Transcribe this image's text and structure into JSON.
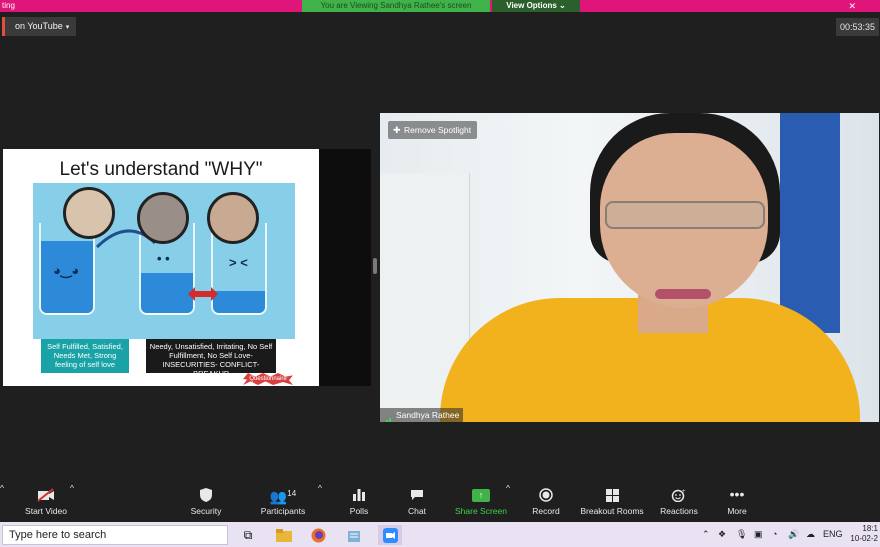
{
  "topbar": {
    "app_title": "ting",
    "viewing_banner": "You are Viewing Sandhya Rathee's screen",
    "view_options": "View Options",
    "close": "✕"
  },
  "live": {
    "label": "on YouTube",
    "caret": "▾"
  },
  "timer": "00:53:35",
  "slide": {
    "title": "Let's understand \"WHY\"",
    "caption_left": "Self Fulfilled, Satisfied, Needs Met, Strong feeling of self love",
    "caption_right": "Needy, Unsatisfied, Irritating, No Self Fulfillment, No Self Love- INSECURITIES- CONFLICT- BREAKUP",
    "badge": "Questionnaire",
    "face_left": "◕‿◕",
    "face_middle": "• •",
    "face_right": "> <"
  },
  "video": {
    "remove_spotlight": "Remove Spotlight",
    "participant_name": "Sandhya Rathee"
  },
  "toolbar": {
    "start_video": "Start Video",
    "security": "Security",
    "participants": "Participants",
    "participants_count": "14",
    "polls": "Polls",
    "chat": "Chat",
    "share_screen": "Share Screen",
    "record": "Record",
    "breakout_rooms": "Breakout Rooms",
    "reactions": "Reactions",
    "more": "More",
    "caret": "^"
  },
  "taskbar": {
    "search_placeholder": "Type here to search",
    "lang": "ENG",
    "time": "18:1",
    "date": "10-02-2"
  },
  "colors": {
    "accent_pink": "#e0157a",
    "share_green": "#3fb24a",
    "shirt_yellow": "#f2b21e"
  }
}
